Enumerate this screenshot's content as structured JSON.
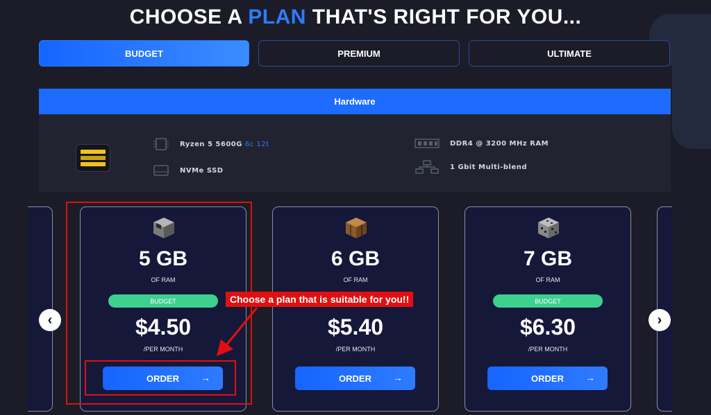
{
  "title": {
    "before": "CHOOSE A ",
    "accent": "PLAN",
    "after": " THAT'S RIGHT FOR YOU..."
  },
  "tabs": [
    {
      "label": "BUDGET",
      "active": true
    },
    {
      "label": "PREMIUM",
      "active": false
    },
    {
      "label": "ULTIMATE",
      "active": false
    }
  ],
  "hardware": {
    "header": "Hardware",
    "cpu": "Ryzen 5 5600G",
    "cpu_threads": "6c 12t",
    "storage": "NVMe SSD",
    "ram": "DDR4 @ 3200 MHz RAM",
    "network": "1 Gbit Multi-blend"
  },
  "plans": [
    {
      "ram": "5 GB",
      "ram_label": "OF RAM",
      "badge": "BUDGET",
      "price": "$4.50",
      "period": "/PER MONTH",
      "order": "ORDER",
      "icon": "furnace-block-icon"
    },
    {
      "ram": "6 GB",
      "ram_label": "OF RAM",
      "badge": "",
      "price": "$5.40",
      "period": "/PER MONTH",
      "order": "ORDER",
      "icon": "crafting-table-icon"
    },
    {
      "ram": "7 GB",
      "ram_label": "OF RAM",
      "badge": "BUDGET",
      "price": "$6.30",
      "period": "/PER MONTH",
      "order": "ORDER",
      "icon": "ore-block-icon"
    }
  ],
  "annotation": {
    "callout": "Choose a plan that is suitable for you!!"
  },
  "colors": {
    "accent": "#2f7bff",
    "badge": "#3dd08e",
    "annotation": "#e01010",
    "background": "#1b1c27",
    "card": "#16183a"
  }
}
